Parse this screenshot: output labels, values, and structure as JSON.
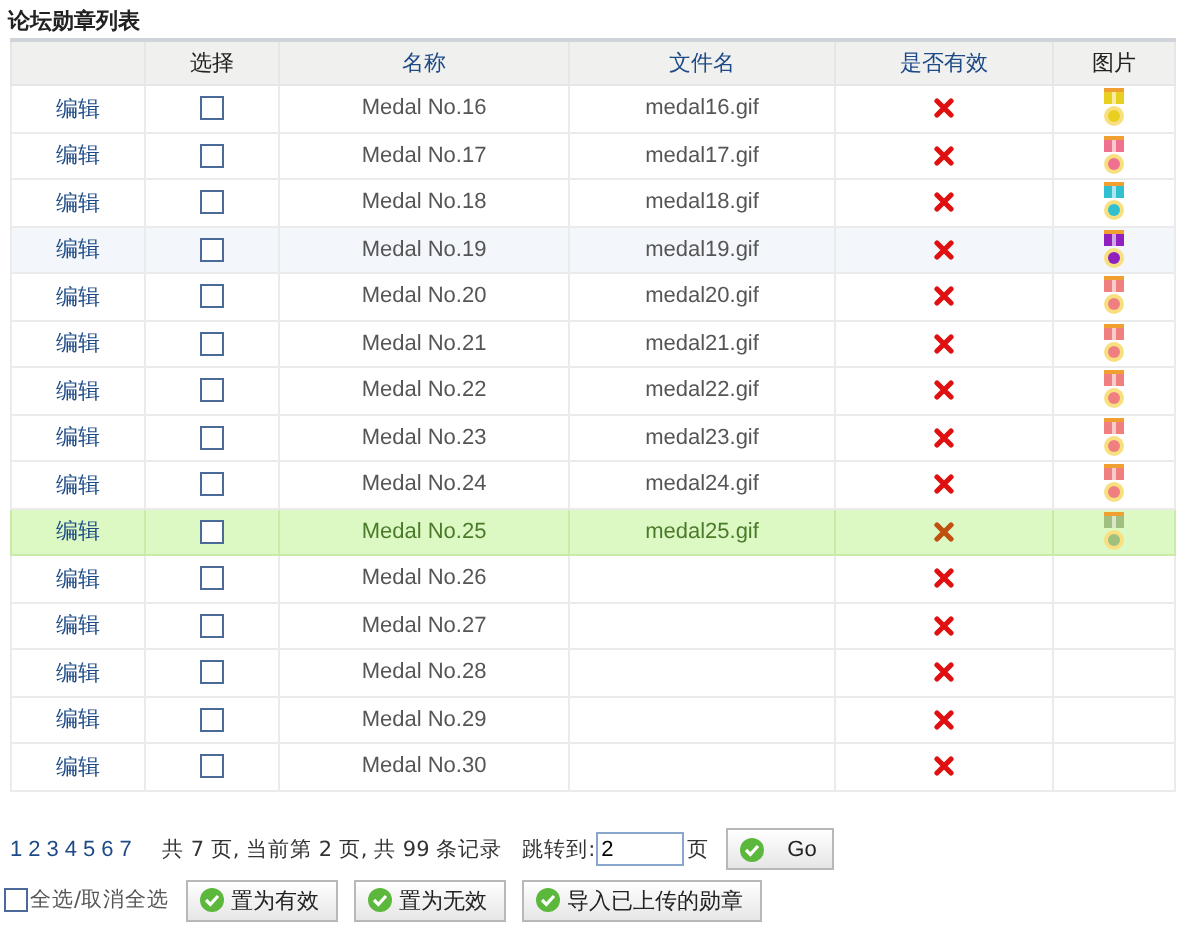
{
  "title": "论坛勋章列表",
  "columns": [
    "",
    "选择",
    "名称",
    "文件名",
    "是否有效",
    "图片"
  ],
  "rows": [
    {
      "edit": "编辑",
      "checked": false,
      "name": "Medal No.16",
      "file": "medal16.gif",
      "valid": false,
      "selected": false,
      "hovered": false
    },
    {
      "edit": "编辑",
      "checked": false,
      "name": "Medal No.17",
      "file": "medal17.gif",
      "valid": false,
      "selected": false,
      "hovered": false
    },
    {
      "edit": "编辑",
      "checked": false,
      "name": "Medal No.18",
      "file": "medal18.gif",
      "valid": false,
      "selected": false,
      "hovered": false
    },
    {
      "edit": "编辑",
      "checked": false,
      "name": "Medal No.19",
      "file": "medal19.gif",
      "valid": false,
      "selected": false,
      "hovered": true
    },
    {
      "edit": "编辑",
      "checked": false,
      "name": "Medal No.20",
      "file": "medal20.gif",
      "valid": false,
      "selected": false,
      "hovered": false
    },
    {
      "edit": "编辑",
      "checked": false,
      "name": "Medal No.21",
      "file": "medal21.gif",
      "valid": false,
      "selected": false,
      "hovered": false
    },
    {
      "edit": "编辑",
      "checked": false,
      "name": "Medal No.22",
      "file": "medal22.gif",
      "valid": false,
      "selected": false,
      "hovered": false
    },
    {
      "edit": "编辑",
      "checked": false,
      "name": "Medal No.23",
      "file": "medal23.gif",
      "valid": false,
      "selected": false,
      "hovered": false
    },
    {
      "edit": "编辑",
      "checked": false,
      "name": "Medal No.24",
      "file": "medal24.gif",
      "valid": false,
      "selected": false,
      "hovered": false
    },
    {
      "edit": "编辑",
      "checked": false,
      "name": "Medal No.25",
      "file": "medal25.gif",
      "valid": false,
      "selected": true,
      "hovered": false
    },
    {
      "edit": "编辑",
      "checked": false,
      "name": "Medal No.26",
      "valid": false,
      "selected": false,
      "hovered": false
    },
    {
      "edit": "编辑",
      "checked": false,
      "name": "Medal No.27",
      "valid": false,
      "selected": false,
      "hovered": false
    },
    {
      "edit": "编辑",
      "checked": false,
      "name": "Medal No.28",
      "valid": false,
      "selected": false,
      "hovered": false
    },
    {
      "edit": "编辑",
      "checked": false,
      "name": "Medal No.29",
      "valid": false,
      "selected": false,
      "hovered": false
    },
    {
      "edit": "编辑",
      "checked": false,
      "name": "Medal No.30",
      "valid": false,
      "selected": false,
      "hovered": false
    }
  ],
  "pager": {
    "pages": [
      "1",
      "2",
      "3",
      "4",
      "5",
      "6",
      "7"
    ],
    "summary": "共 7 页, 当前第 2 页, 共 99 条记录",
    "jump_label": "跳转到:",
    "jump_value": "2",
    "unit": "页",
    "go": "Go"
  },
  "select_all": {
    "label": "全选/取消全选",
    "checked": false
  },
  "actions": [
    "置为有效",
    "置为无效",
    "导入已上传的勋章"
  ]
}
